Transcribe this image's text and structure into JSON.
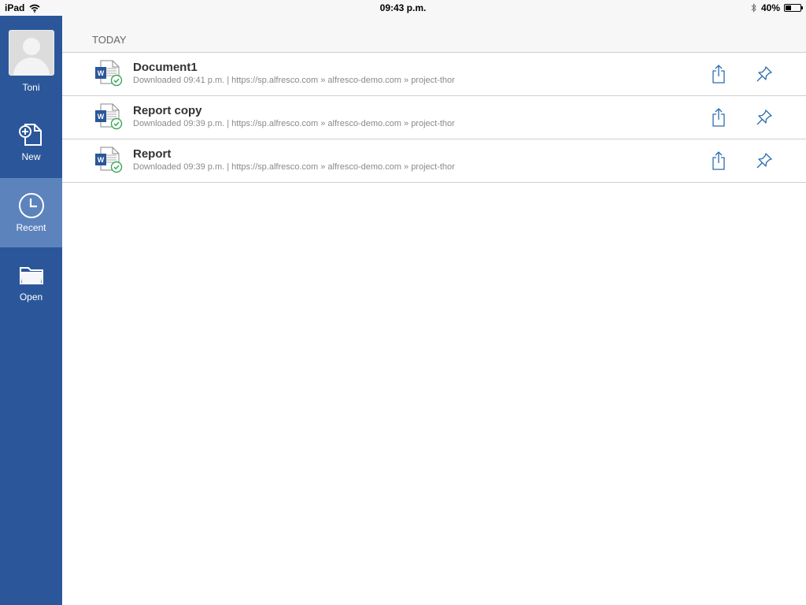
{
  "status_bar": {
    "device": "iPad",
    "time": "09:43 p.m.",
    "battery": "40%",
    "battery_level": 0.4
  },
  "sidebar": {
    "user_name": "Toni",
    "items": [
      {
        "label": "New",
        "icon": "new-document-icon"
      },
      {
        "label": "Recent",
        "icon": "clock-icon",
        "active": true
      },
      {
        "label": "Open",
        "icon": "folder-icon"
      }
    ]
  },
  "main": {
    "section_title": "TODAY",
    "documents": [
      {
        "title": "Document1",
        "subtitle": "Downloaded 09:41 p.m. | https://sp.alfresco.com » alfresco-demo.com » project-thor"
      },
      {
        "title": "Report copy",
        "subtitle": "Downloaded 09:39 p.m. | https://sp.alfresco.com » alfresco-demo.com » project-thor"
      },
      {
        "title": "Report",
        "subtitle": "Downloaded 09:39 p.m. | https://sp.alfresco.com » alfresco-demo.com » project-thor"
      }
    ]
  },
  "colors": {
    "sidebar": "#2b579a",
    "sidebar_active": "#5d83bd",
    "word_blue": "#2b579a",
    "sync_green": "#3aa85c",
    "action_blue": "#2b6cb0"
  }
}
